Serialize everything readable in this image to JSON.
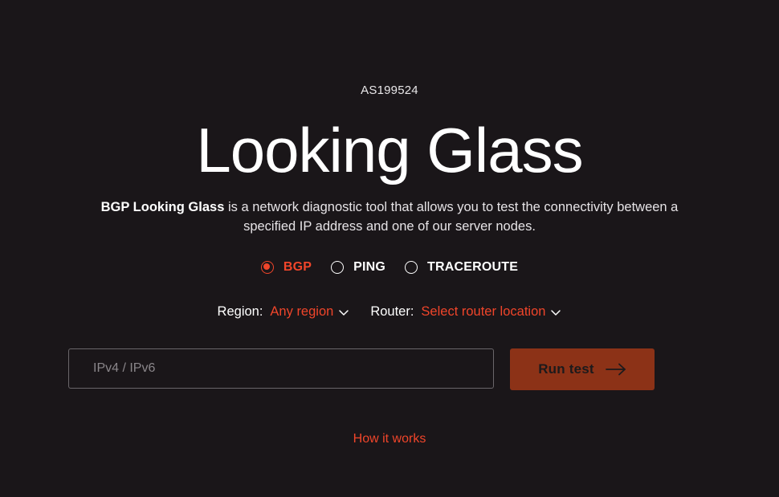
{
  "header": {
    "asn": "AS199524",
    "title": "Looking Glass"
  },
  "description": {
    "bold": "BGP Looking Glass",
    "line1_rest": " is a network diagnostic tool that allows you to test the connectivity between a",
    "line2": "specified IP address and one of our server nodes."
  },
  "modes": {
    "selected": "BGP",
    "items": [
      {
        "label": "BGP",
        "selected": true
      },
      {
        "label": "PING",
        "selected": false
      },
      {
        "label": "TRACEROUTE",
        "selected": false
      }
    ]
  },
  "selectors": {
    "region": {
      "label": "Region:",
      "value": "Any region",
      "icon": "chevron-down-icon"
    },
    "router": {
      "label": "Router:",
      "value": "Select router location",
      "icon": "chevron-down-icon"
    }
  },
  "form": {
    "ip_placeholder": "IPv4 / IPv6",
    "ip_value": "",
    "run_label": "Run test",
    "run_icon": "arrow-right-icon"
  },
  "footer": {
    "how_it_works": "How it works"
  },
  "colors": {
    "background": "#1a1619",
    "accent": "#f0452a",
    "button": "#8c3217"
  }
}
